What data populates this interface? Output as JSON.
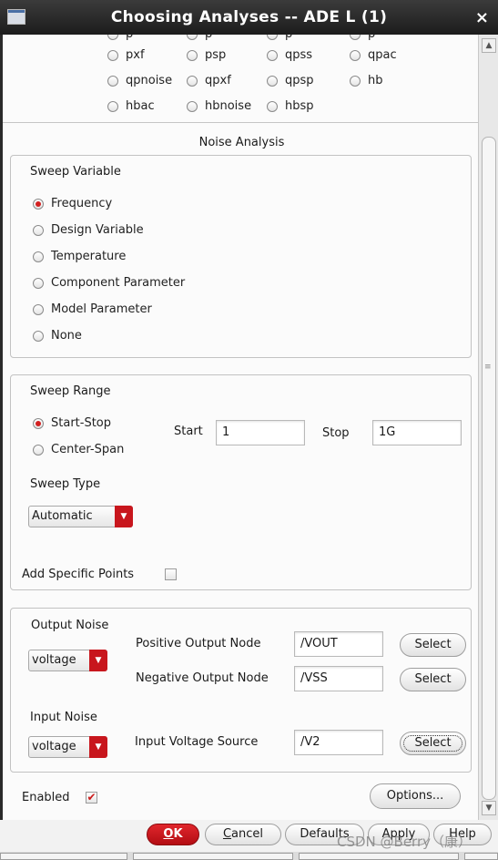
{
  "window": {
    "title": "Choosing Analyses -- ADE L (1)",
    "close_glyph": "×"
  },
  "analysis_types": {
    "cut_row": [
      "p",
      "p",
      "p",
      "p"
    ],
    "rows": [
      [
        "pxf",
        "psp",
        "qpss",
        "qpac"
      ],
      [
        "qpnoise",
        "qpxf",
        "qpsp",
        "hb"
      ],
      [
        "hbac",
        "hbnoise",
        "hbsp"
      ]
    ]
  },
  "section_title": "Noise Analysis",
  "sweep_variable": {
    "title": "Sweep Variable",
    "options": [
      "Frequency",
      "Design Variable",
      "Temperature",
      "Component Parameter",
      "Model Parameter",
      "None"
    ],
    "selected": "Frequency"
  },
  "sweep_range": {
    "title": "Sweep Range",
    "modes": [
      "Start-Stop",
      "Center-Span"
    ],
    "selected": "Start-Stop",
    "start_label": "Start",
    "start_value": "1",
    "stop_label": "Stop",
    "stop_value": "1G",
    "sweep_type_label": "Sweep Type",
    "sweep_type_value": "Automatic",
    "add_points_label": "Add Specific Points",
    "add_points_checked": false
  },
  "output_noise": {
    "title": "Output Noise",
    "type_value": "voltage",
    "positive_label": "Positive Output Node",
    "positive_value": "/VOUT",
    "negative_label": "Negative Output Node",
    "negative_value": "/VSS",
    "select_label": "Select"
  },
  "input_noise": {
    "title": "Input Noise",
    "type_value": "voltage",
    "source_label": "Input Voltage Source",
    "source_value": "/V2",
    "select_label": "Select"
  },
  "enabled": {
    "label": "Enabled",
    "checked": true,
    "check_glyph": "✔"
  },
  "options_button": "Options...",
  "footer_buttons": {
    "ok_pre": "",
    "ok_key": "O",
    "ok_post": "K",
    "cancel_pre": "",
    "cancel_key": "C",
    "cancel_post": "ancel",
    "defaults": "Defaults",
    "apply": "Apply",
    "help": "Help"
  },
  "watermark": "CSDN @Berry（康）",
  "colors": {
    "accent_red": "#c8161d",
    "titlebar": "#2b2b2b"
  }
}
